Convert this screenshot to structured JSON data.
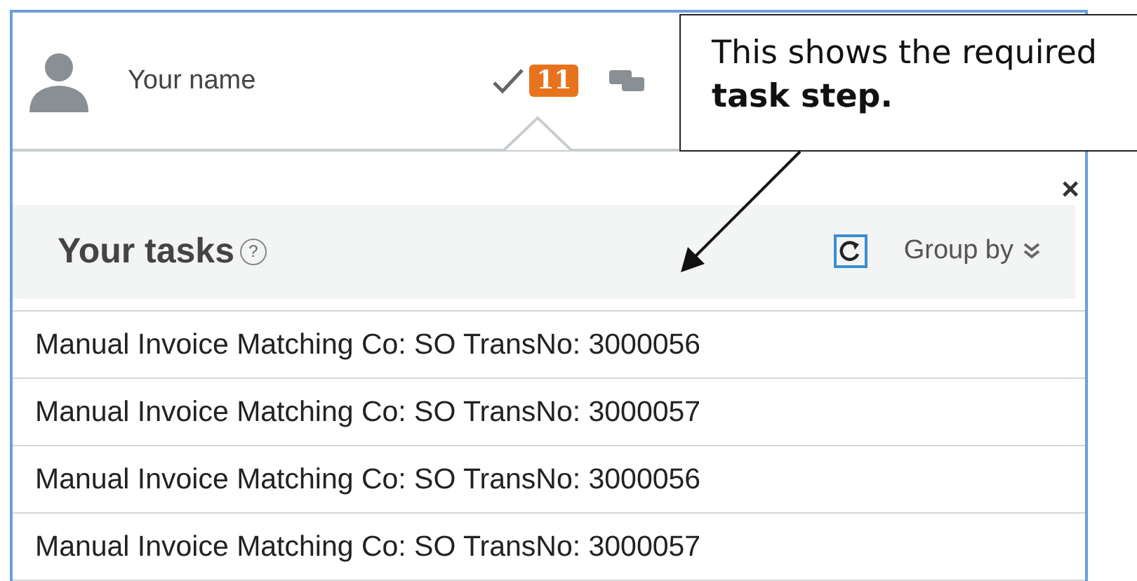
{
  "header": {
    "user_name": "Your name",
    "task_count": "11"
  },
  "tasks_panel": {
    "title": "Your tasks",
    "help": "?",
    "group_by": "Group by",
    "close": "×"
  },
  "tasks": [
    {
      "label": "Manual Invoice Matching Co: SO TransNo: 3000056"
    },
    {
      "label": "Manual Invoice Matching Co: SO TransNo: 3000057"
    },
    {
      "label": "Manual Invoice Matching Co: SO TransNo: 3000056"
    },
    {
      "label": "Manual Invoice Matching Co: SO TransNo: 3000057"
    }
  ],
  "callout": {
    "text": "This shows the required **task step.**"
  }
}
